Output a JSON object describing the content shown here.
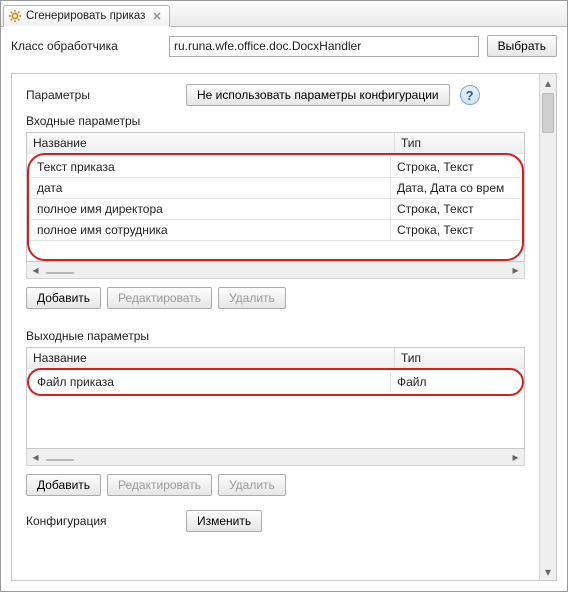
{
  "tab": {
    "title": "Сгенерировать приказ"
  },
  "handler": {
    "label": "Класс обработчика",
    "value": "ru.runa.wfe.office.doc.DocxHandler",
    "choose": "Выбрать"
  },
  "params": {
    "label": "Параметры",
    "noConfigBtn": "Не использовать параметры конфигурации"
  },
  "inParams": {
    "title": "Входные параметры",
    "colName": "Название",
    "colType": "Тип",
    "rows": [
      {
        "name": "Текст приказа",
        "type": "Строка, Текст"
      },
      {
        "name": "дата",
        "type": "Дата, Дата со врем"
      },
      {
        "name": "полное имя директора",
        "type": "Строка, Текст"
      },
      {
        "name": "полное имя сотрудника",
        "type": "Строка, Текст"
      }
    ]
  },
  "outParams": {
    "title": "Выходные параметры",
    "colName": "Название",
    "colType": "Тип",
    "rows": [
      {
        "name": "Файл приказа",
        "type": "Файл"
      }
    ]
  },
  "buttons": {
    "add": "Добавить",
    "edit": "Редактировать",
    "delete": "Удалить"
  },
  "config": {
    "label": "Конфигурация",
    "change": "Изменить"
  }
}
